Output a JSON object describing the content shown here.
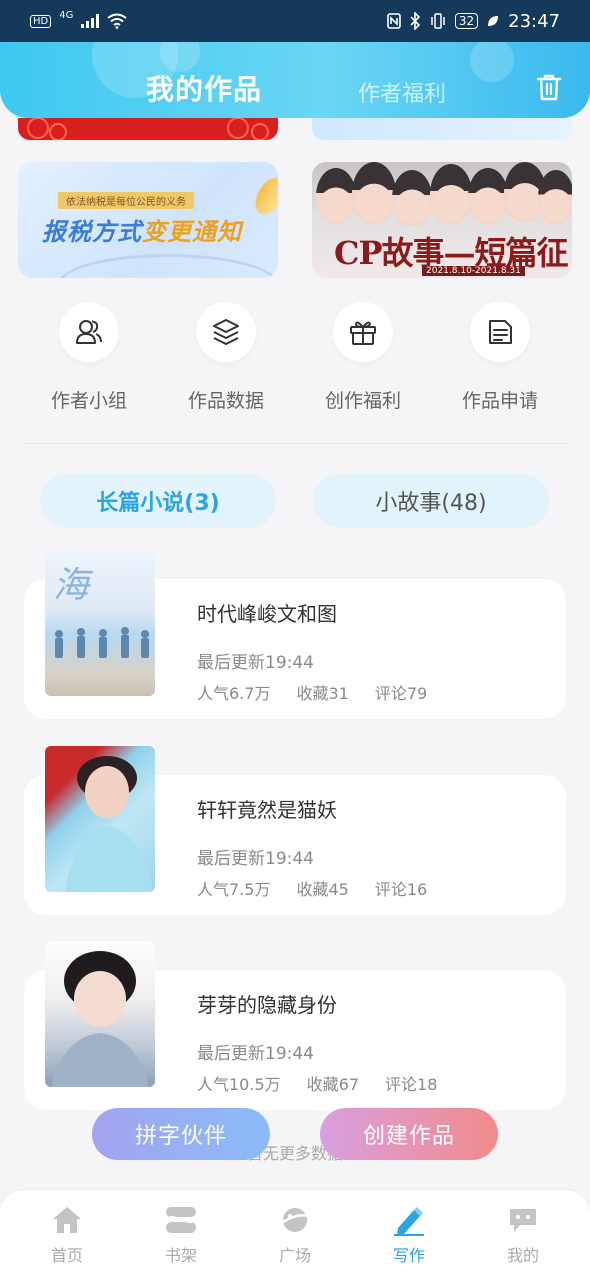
{
  "status_bar": {
    "left_badge": "HD",
    "network": "4G",
    "battery": "32",
    "time": "23:47"
  },
  "header": {
    "tab_active": "我的作品",
    "tab_inactive": "作者福利",
    "delete_icon": "trash-icon"
  },
  "banners": {
    "tax": {
      "small": "依法纳税是每位公民的义务",
      "title_part1": "报税方式",
      "title_part2": "变更通知"
    },
    "cp": {
      "title": "CP故事—短篇征文",
      "sub": "2021.8.10-2021.8.31"
    }
  },
  "quick_actions": [
    {
      "label": "作者小组",
      "icon": "group-icon"
    },
    {
      "label": "作品数据",
      "icon": "layers-icon"
    },
    {
      "label": "创作福利",
      "icon": "gift-icon"
    },
    {
      "label": "作品申请",
      "icon": "document-icon"
    }
  ],
  "categories": {
    "long": "长篇小说(3)",
    "short": "小故事(48)"
  },
  "works": [
    {
      "title": "时代峰峻文和图",
      "updated": "最后更新19:44",
      "popularity": "人气6.7万",
      "favorites": "收藏31",
      "comments": "评论79",
      "cover_text": "海"
    },
    {
      "title": "轩轩竟然是猫妖",
      "updated": "最后更新19:44",
      "popularity": "人气7.5万",
      "favorites": "收藏45",
      "comments": "评论16"
    },
    {
      "title": "芽芽的隐藏身份",
      "updated": "最后更新19:44",
      "popularity": "人气10.5万",
      "favorites": "收藏67",
      "comments": "评论18"
    }
  ],
  "footer_text": "暂无更多数据",
  "fab": {
    "partner": "拼字伙伴",
    "create": "创建作品"
  },
  "bottom_nav": [
    {
      "label": "首页",
      "icon": "home-icon"
    },
    {
      "label": "书架",
      "icon": "bookshelf-icon"
    },
    {
      "label": "广场",
      "icon": "planet-icon"
    },
    {
      "label": "写作",
      "icon": "pen-icon",
      "active": true
    },
    {
      "label": "我的",
      "icon": "chat-icon"
    }
  ],
  "colors": {
    "accent": "#2ba4e4",
    "header_start": "#3ec8f0",
    "header_end": "#3ab9ee",
    "create_gradient_end": "#f28a8a"
  }
}
